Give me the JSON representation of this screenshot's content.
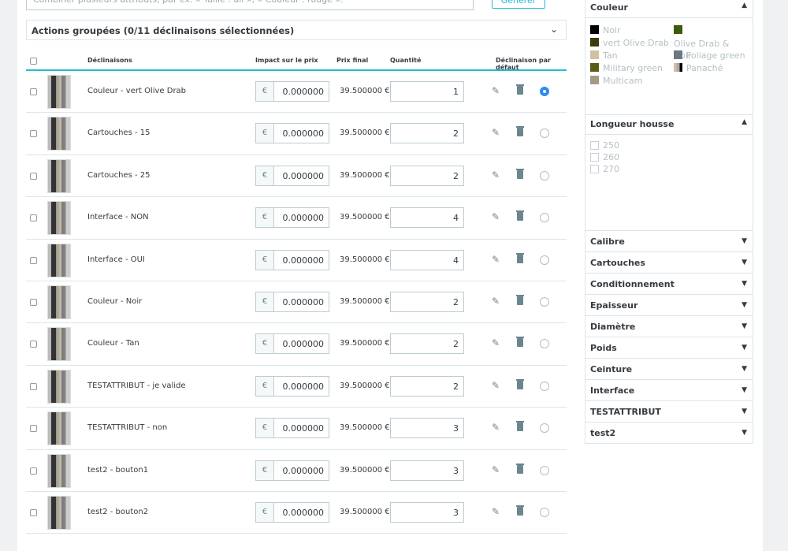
{
  "top": {
    "placeholder": "Combiner plusieurs attributs, par ex. « Taille : all », « Couleur : rouge ».",
    "generate": "Générer"
  },
  "bulk": {
    "label": "Actions groupées (0/11 déclinaisons sélectionnées)"
  },
  "headers": {
    "declinaisons": "Déclinaisons",
    "impact": "Impact sur le prix",
    "final": "Prix final",
    "qty": "Quantité",
    "default": "Déclinaison par défaut"
  },
  "rows": [
    {
      "name": "Couleur - vert Olive Drab",
      "cur": "€",
      "impact": "0.000000",
      "final": "39.500000 €",
      "qty": "1",
      "default": true
    },
    {
      "name": "Cartouches - 15",
      "cur": "€",
      "impact": "0.000000",
      "final": "39.500000 €",
      "qty": "2",
      "default": false
    },
    {
      "name": "Cartouches - 25",
      "cur": "€",
      "impact": "0.000000",
      "final": "39.500000 €",
      "qty": "2",
      "default": false
    },
    {
      "name": "Interface - NON",
      "cur": "€",
      "impact": "0.000000",
      "final": "39.500000 €",
      "qty": "4",
      "default": false
    },
    {
      "name": "Interface - OUI",
      "cur": "€",
      "impact": "0.000000",
      "final": "39.500000 €",
      "qty": "4",
      "default": false
    },
    {
      "name": "Couleur - Noir",
      "cur": "€",
      "impact": "0.000000",
      "final": "39.500000 €",
      "qty": "2",
      "default": false
    },
    {
      "name": "Couleur - Tan",
      "cur": "€",
      "impact": "0.000000",
      "final": "39.500000 €",
      "qty": "2",
      "default": false
    },
    {
      "name": "TESTATTRIBUT - je valide",
      "cur": "€",
      "impact": "0.000000",
      "final": "39.500000 €",
      "qty": "2",
      "default": false
    },
    {
      "name": "TESTATTRIBUT - non",
      "cur": "€",
      "impact": "0.000000",
      "final": "39.500000 €",
      "qty": "3",
      "default": false
    },
    {
      "name": "test2 - bouton1",
      "cur": "€",
      "impact": "0.000000",
      "final": "39.500000 €",
      "qty": "3",
      "default": false
    },
    {
      "name": "test2 - bouton2",
      "cur": "€",
      "impact": "0.000000",
      "final": "39.500000 €",
      "qty": "3",
      "default": false
    }
  ],
  "sidebar": {
    "couleur": {
      "title": "Couleur",
      "items": [
        {
          "label": "Noir",
          "color": "#000000"
        },
        {
          "label": "vert Olive Drab",
          "color": "#3d3a0c"
        },
        {
          "label": "Tan",
          "color": "#d2bfa6"
        },
        {
          "label": "Military green",
          "color": "#5a5c14"
        },
        {
          "label": "Multicam",
          "color": "#a49a84"
        },
        {
          "label": "Olive Drab & Noir",
          "color": "#3b5c0c"
        },
        {
          "label": "Foliage green",
          "color": "#687a80"
        },
        {
          "label": "Panaché",
          "color": "#888888"
        }
      ]
    },
    "longueur": {
      "title": "Longueur housse",
      "items": [
        "250",
        "260",
        "270"
      ]
    },
    "groups": [
      "Calibre",
      "Cartouches",
      "Conditionnement",
      "Epaisseur",
      "Diamètre",
      "Poids",
      "Ceinture",
      "Interface",
      "TESTATTRIBUT",
      "test2"
    ]
  },
  "colors": {
    "accent": "#25b9d7",
    "radio": "#2d8cf0"
  }
}
